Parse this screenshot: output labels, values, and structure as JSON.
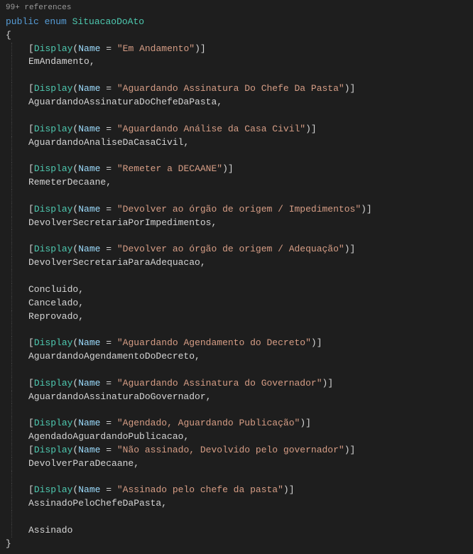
{
  "codelens": "99+ references",
  "declaration": {
    "modifier": "public",
    "keyword": "enum",
    "typeName": "SituacaoDoAto"
  },
  "openBrace": "{",
  "closeBrace": "}",
  "attrName": "Display",
  "paramName": "Name",
  "members": [
    {
      "display": "Em Andamento",
      "name": "EmAndamento"
    },
    {
      "display": "Aguardando Assinatura Do Chefe Da Pasta",
      "name": "AguardandoAssinaturaDoChefeDaPasta"
    },
    {
      "display": "Aguardando Análise da Casa Civil",
      "name": "AguardandoAnaliseDaCasaCivil"
    },
    {
      "display": "Remeter a DECAANE",
      "name": "RemeterDecaane"
    },
    {
      "display": "Devolver ao órgão de origem / Impedimentos",
      "name": "DevolverSecretariaPorImpedimentos"
    },
    {
      "display": "Devolver ao órgão de origem / Adequação",
      "name": "DevolverSecretariaParaAdequacao"
    }
  ],
  "bareMembers1": [
    "Concluido",
    "Cancelado",
    "Reprovado"
  ],
  "members2": [
    {
      "display": "Aguardando Agendamento do Decreto",
      "name": "AguardandoAgendamentoDoDecreto"
    },
    {
      "display": "Aguardando Assinatura do Governador",
      "name": "AguardandoAssinaturaDoGovernador"
    }
  ],
  "members3": [
    {
      "display": "Agendado, Aguardando Publicação",
      "name": "AgendadoAguardandoPublicacao"
    },
    {
      "display": "Não assinado, Devolvido pelo governador",
      "name": "DevolverParaDecaane"
    }
  ],
  "members4": [
    {
      "display": "Assinado pelo chefe da pasta",
      "name": "AssinadoPeloChefeDaPasta"
    }
  ],
  "lastMember": "Assinado"
}
